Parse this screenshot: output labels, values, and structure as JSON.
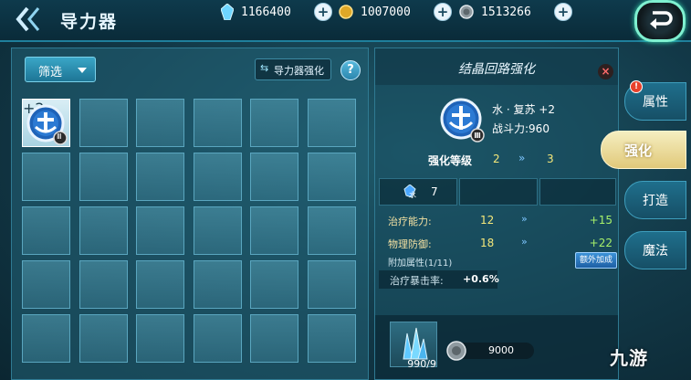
{
  "header": {
    "title": "导力器",
    "resources": [
      {
        "icon": "crystal-icon",
        "value": "1166400"
      },
      {
        "icon": "gold-coin-icon",
        "value": "1007000"
      },
      {
        "icon": "silver-coin-icon",
        "value": "1513266"
      }
    ]
  },
  "left": {
    "filter_label": "筛选",
    "enhance_label": "导力器强化",
    "help_label": "?",
    "item_plus": "+2",
    "item_rank": "Ⅲ"
  },
  "right": {
    "title": "结晶回路强化",
    "close_label": "×",
    "item_name": "水 · 复苏 +2",
    "item_power": "战斗力:960",
    "level": {
      "label": "强化等级",
      "from": "2",
      "arrow": "»",
      "to": "3"
    },
    "material": {
      "element": "水",
      "count": "7"
    },
    "stats": [
      {
        "label": "治疗能力:",
        "from": "12",
        "arrow": "»",
        "to": "+15"
      },
      {
        "label": "物理防御:",
        "from": "18",
        "arrow": "»",
        "to": "+22"
      }
    ],
    "extra_label": "附加属性(1/11)",
    "extra_button": "额外加成",
    "crit_label": "治疗暴击率:",
    "crit_value": "+0.6%",
    "crystal_count": "990/9",
    "cost_value": "9000"
  },
  "tabs": [
    {
      "label": "属性",
      "badge": "!"
    },
    {
      "label": "强化"
    },
    {
      "label": "打造"
    },
    {
      "label": "魔法"
    }
  ],
  "watermark": "九游",
  "colors": {
    "accent_gold": "#f4e77a",
    "accent_green": "#a6f06a",
    "accent_cyan": "#7ff0d0"
  }
}
